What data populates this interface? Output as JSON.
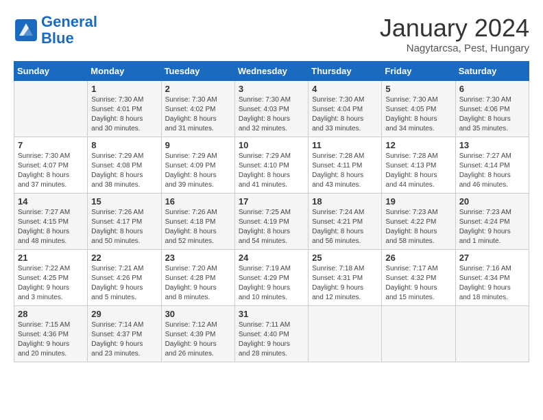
{
  "header": {
    "logo_line1": "General",
    "logo_line2": "Blue",
    "month_year": "January 2024",
    "location": "Nagytarcsa, Pest, Hungary"
  },
  "weekdays": [
    "Sunday",
    "Monday",
    "Tuesday",
    "Wednesday",
    "Thursday",
    "Friday",
    "Saturday"
  ],
  "weeks": [
    [
      {
        "day": "",
        "content": ""
      },
      {
        "day": "1",
        "content": "Sunrise: 7:30 AM\nSunset: 4:01 PM\nDaylight: 8 hours\nand 30 minutes."
      },
      {
        "day": "2",
        "content": "Sunrise: 7:30 AM\nSunset: 4:02 PM\nDaylight: 8 hours\nand 31 minutes."
      },
      {
        "day": "3",
        "content": "Sunrise: 7:30 AM\nSunset: 4:03 PM\nDaylight: 8 hours\nand 32 minutes."
      },
      {
        "day": "4",
        "content": "Sunrise: 7:30 AM\nSunset: 4:04 PM\nDaylight: 8 hours\nand 33 minutes."
      },
      {
        "day": "5",
        "content": "Sunrise: 7:30 AM\nSunset: 4:05 PM\nDaylight: 8 hours\nand 34 minutes."
      },
      {
        "day": "6",
        "content": "Sunrise: 7:30 AM\nSunset: 4:06 PM\nDaylight: 8 hours\nand 35 minutes."
      }
    ],
    [
      {
        "day": "7",
        "content": "Sunrise: 7:30 AM\nSunset: 4:07 PM\nDaylight: 8 hours\nand 37 minutes."
      },
      {
        "day": "8",
        "content": "Sunrise: 7:29 AM\nSunset: 4:08 PM\nDaylight: 8 hours\nand 38 minutes."
      },
      {
        "day": "9",
        "content": "Sunrise: 7:29 AM\nSunset: 4:09 PM\nDaylight: 8 hours\nand 39 minutes."
      },
      {
        "day": "10",
        "content": "Sunrise: 7:29 AM\nSunset: 4:10 PM\nDaylight: 8 hours\nand 41 minutes."
      },
      {
        "day": "11",
        "content": "Sunrise: 7:28 AM\nSunset: 4:11 PM\nDaylight: 8 hours\nand 43 minutes."
      },
      {
        "day": "12",
        "content": "Sunrise: 7:28 AM\nSunset: 4:13 PM\nDaylight: 8 hours\nand 44 minutes."
      },
      {
        "day": "13",
        "content": "Sunrise: 7:27 AM\nSunset: 4:14 PM\nDaylight: 8 hours\nand 46 minutes."
      }
    ],
    [
      {
        "day": "14",
        "content": "Sunrise: 7:27 AM\nSunset: 4:15 PM\nDaylight: 8 hours\nand 48 minutes."
      },
      {
        "day": "15",
        "content": "Sunrise: 7:26 AM\nSunset: 4:17 PM\nDaylight: 8 hours\nand 50 minutes."
      },
      {
        "day": "16",
        "content": "Sunrise: 7:26 AM\nSunset: 4:18 PM\nDaylight: 8 hours\nand 52 minutes."
      },
      {
        "day": "17",
        "content": "Sunrise: 7:25 AM\nSunset: 4:19 PM\nDaylight: 8 hours\nand 54 minutes."
      },
      {
        "day": "18",
        "content": "Sunrise: 7:24 AM\nSunset: 4:21 PM\nDaylight: 8 hours\nand 56 minutes."
      },
      {
        "day": "19",
        "content": "Sunrise: 7:23 AM\nSunset: 4:22 PM\nDaylight: 8 hours\nand 58 minutes."
      },
      {
        "day": "20",
        "content": "Sunrise: 7:23 AM\nSunset: 4:24 PM\nDaylight: 9 hours\nand 1 minute."
      }
    ],
    [
      {
        "day": "21",
        "content": "Sunrise: 7:22 AM\nSunset: 4:25 PM\nDaylight: 9 hours\nand 3 minutes."
      },
      {
        "day": "22",
        "content": "Sunrise: 7:21 AM\nSunset: 4:26 PM\nDaylight: 9 hours\nand 5 minutes."
      },
      {
        "day": "23",
        "content": "Sunrise: 7:20 AM\nSunset: 4:28 PM\nDaylight: 9 hours\nand 8 minutes."
      },
      {
        "day": "24",
        "content": "Sunrise: 7:19 AM\nSunset: 4:29 PM\nDaylight: 9 hours\nand 10 minutes."
      },
      {
        "day": "25",
        "content": "Sunrise: 7:18 AM\nSunset: 4:31 PM\nDaylight: 9 hours\nand 12 minutes."
      },
      {
        "day": "26",
        "content": "Sunrise: 7:17 AM\nSunset: 4:32 PM\nDaylight: 9 hours\nand 15 minutes."
      },
      {
        "day": "27",
        "content": "Sunrise: 7:16 AM\nSunset: 4:34 PM\nDaylight: 9 hours\nand 18 minutes."
      }
    ],
    [
      {
        "day": "28",
        "content": "Sunrise: 7:15 AM\nSunset: 4:36 PM\nDaylight: 9 hours\nand 20 minutes."
      },
      {
        "day": "29",
        "content": "Sunrise: 7:14 AM\nSunset: 4:37 PM\nDaylight: 9 hours\nand 23 minutes."
      },
      {
        "day": "30",
        "content": "Sunrise: 7:12 AM\nSunset: 4:39 PM\nDaylight: 9 hours\nand 26 minutes."
      },
      {
        "day": "31",
        "content": "Sunrise: 7:11 AM\nSunset: 4:40 PM\nDaylight: 9 hours\nand 28 minutes."
      },
      {
        "day": "",
        "content": ""
      },
      {
        "day": "",
        "content": ""
      },
      {
        "day": "",
        "content": ""
      }
    ]
  ]
}
